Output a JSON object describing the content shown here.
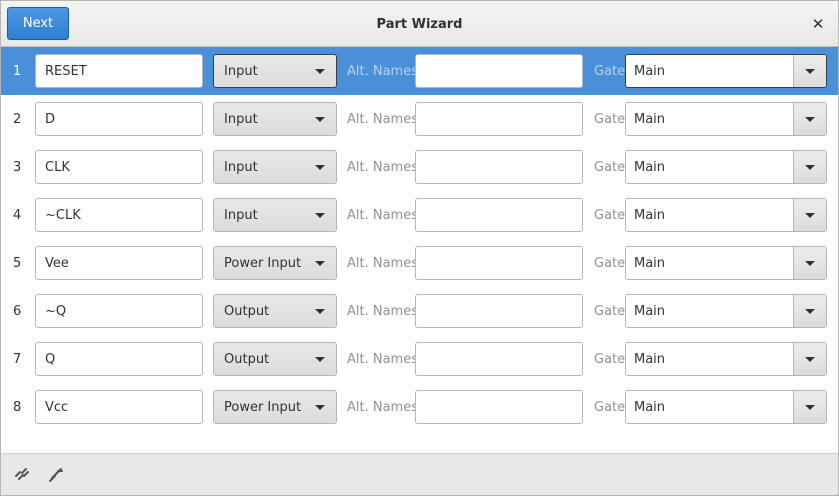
{
  "window": {
    "title": "Part Wizard",
    "next_label": "Next",
    "close_glyph": "✕"
  },
  "labels": {
    "alt_names": "Alt. Names",
    "gate": "Gate"
  },
  "rows": [
    {
      "num": "1",
      "name": "RESET",
      "type": "Input",
      "alt": "",
      "gate": "Main",
      "selected": true
    },
    {
      "num": "2",
      "name": "D",
      "type": "Input",
      "alt": "",
      "gate": "Main",
      "selected": false
    },
    {
      "num": "3",
      "name": "CLK",
      "type": "Input",
      "alt": "",
      "gate": "Main",
      "selected": false
    },
    {
      "num": "4",
      "name": "~CLK",
      "type": "Input",
      "alt": "",
      "gate": "Main",
      "selected": false
    },
    {
      "num": "5",
      "name": "Vee",
      "type": "Power Input",
      "alt": "",
      "gate": "Main",
      "selected": false
    },
    {
      "num": "6",
      "name": "~Q",
      "type": "Output",
      "alt": "",
      "gate": "Main",
      "selected": false
    },
    {
      "num": "7",
      "name": "Q",
      "type": "Output",
      "alt": "",
      "gate": "Main",
      "selected": false
    },
    {
      "num": "8",
      "name": "Vcc",
      "type": "Power Input",
      "alt": "",
      "gate": "Main",
      "selected": false
    }
  ],
  "footer": {
    "icons": [
      "unlink-icon",
      "link-icon"
    ]
  },
  "colors": {
    "selection": "#4a90d9",
    "next_button": "#3584e4"
  }
}
